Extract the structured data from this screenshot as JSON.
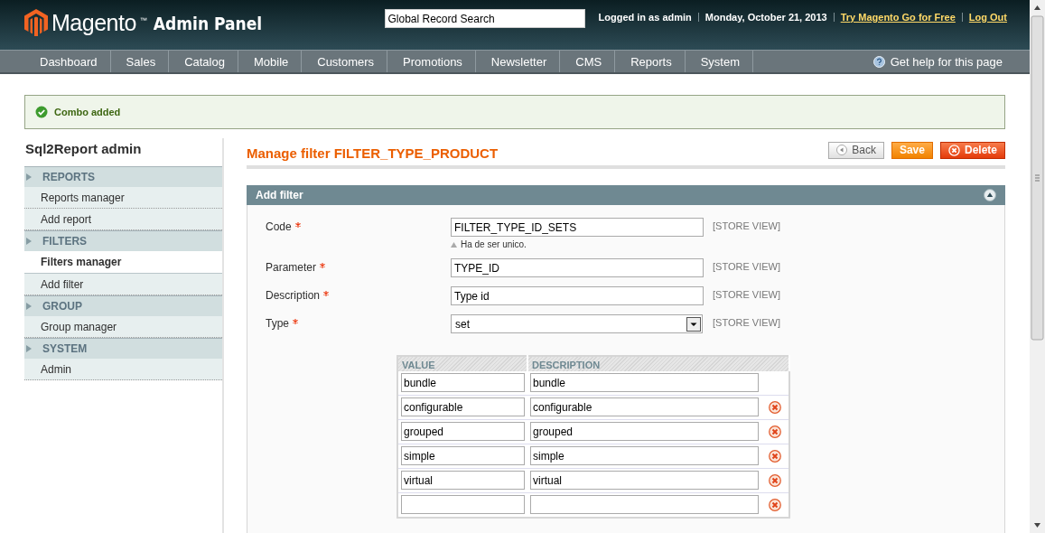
{
  "header": {
    "logo_text": "Magento",
    "logo_mark": "™",
    "logo_suffix": "Admin Panel",
    "search": {
      "value": "Global Record Search"
    },
    "user_info": [
      {
        "kind": "text",
        "text": "Logged in as admin"
      },
      {
        "kind": "text",
        "text": "Monday, October 21, 2013"
      },
      {
        "kind": "link",
        "text": "Try Magento Go for Free"
      },
      {
        "kind": "link",
        "text": "Log Out"
      }
    ]
  },
  "nav": {
    "items": [
      {
        "label": "Dashboard",
        "selected": false
      },
      {
        "label": "Sales",
        "selected": false
      },
      {
        "label": "Catalog",
        "selected": false
      },
      {
        "label": "Mobile",
        "selected": false
      },
      {
        "label": "Customers",
        "selected": false
      },
      {
        "label": "Promotions",
        "selected": false
      },
      {
        "label": "Newsletter",
        "selected": false
      },
      {
        "label": "CMS",
        "selected": false
      },
      {
        "label": "Reports",
        "selected": false
      },
      {
        "label": "System",
        "selected": false
      }
    ],
    "help": "Get help for this page"
  },
  "message": {
    "kind": "success",
    "text": "Combo added"
  },
  "sidebar": {
    "title": "Sql2Report admin",
    "sections": [
      {
        "label": "REPORTS",
        "children": [
          {
            "label": "Reports manager",
            "selected": false
          },
          {
            "label": "Add report",
            "selected": false
          }
        ]
      },
      {
        "label": "FILTERS",
        "children": [
          {
            "label": "Filters manager",
            "selected": true
          },
          {
            "label": "Add filter",
            "selected": false
          }
        ]
      },
      {
        "label": "GROUP",
        "children": [
          {
            "label": "Group manager",
            "selected": false
          }
        ]
      },
      {
        "label": "SYSTEM",
        "children": [
          {
            "label": "Admin",
            "selected": false
          }
        ]
      }
    ]
  },
  "page": {
    "title": "Manage filter FILTER_TYPE_PRODUCT",
    "buttons": [
      {
        "kind": "back",
        "label": "Back"
      },
      {
        "kind": "save",
        "label": "Save"
      },
      {
        "kind": "delete",
        "label": "Delete"
      }
    ]
  },
  "section": {
    "title": "Add filter",
    "expanded": true,
    "fields": [
      {
        "label": "Code",
        "required": true,
        "kind": "text",
        "value": "FILTER_TYPE_ID_SETS",
        "note": "Ha de ser unico.",
        "scope": "[STORE VIEW]"
      },
      {
        "label": "Parameter",
        "required": true,
        "kind": "text",
        "value": "TYPE_ID",
        "scope": "[STORE VIEW]"
      },
      {
        "label": "Description",
        "required": true,
        "kind": "text",
        "value": "Type id",
        "scope": "[STORE VIEW]"
      },
      {
        "label": "Type",
        "required": true,
        "kind": "select",
        "value": "set",
        "scope": "[STORE VIEW]"
      }
    ],
    "table": {
      "columns": [
        "VALUE",
        "DESCRIPTION"
      ],
      "rows": [
        {
          "value": "bundle",
          "description": "bundle",
          "removable": false
        },
        {
          "value": "configurable",
          "description": "configurable",
          "removable": true
        },
        {
          "value": "grouped",
          "description": "grouped",
          "removable": true
        },
        {
          "value": "simple",
          "description": "simple",
          "removable": true
        },
        {
          "value": "virtual",
          "description": "virtual",
          "removable": true
        },
        {
          "removable": true
        }
      ]
    }
  }
}
